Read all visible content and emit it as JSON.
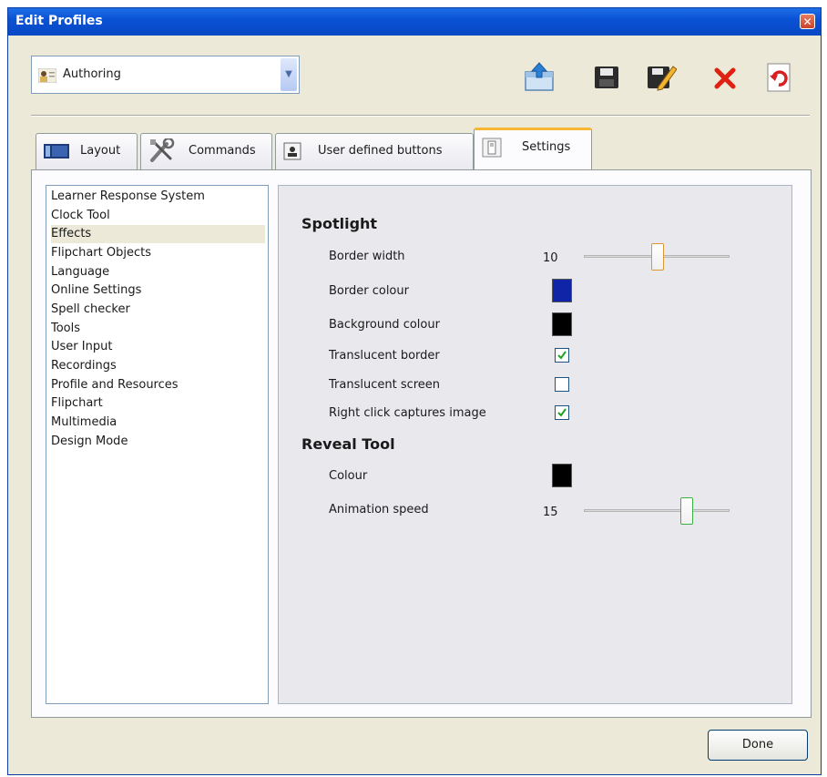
{
  "window": {
    "title": "Edit Profiles"
  },
  "profile_select": {
    "value": "Authoring"
  },
  "toolbar": {
    "icons": [
      "export-icon",
      "save-icon",
      "rename-icon",
      "delete-icon",
      "refresh-icon"
    ],
    "delete_color": "#e02010"
  },
  "tabs": [
    {
      "label": "Layout",
      "icon": "layout-icon"
    },
    {
      "label": "Commands",
      "icon": "tools-icon"
    },
    {
      "label": "User defined buttons",
      "icon": "user-button-icon"
    },
    {
      "label": "Settings",
      "icon": "settings-icon",
      "active": true
    }
  ],
  "settings_list": {
    "items": [
      "Learner Response System",
      "Clock Tool",
      "Effects",
      "Flipchart Objects",
      "Language",
      "Online Settings",
      "Spell checker",
      "Tools",
      "User Input",
      "Recordings",
      "Profile and Resources",
      "Flipchart",
      "Multimedia",
      "Design Mode"
    ],
    "selected": "Effects"
  },
  "spotlight": {
    "title": "Spotlight",
    "border_width": {
      "label": "Border width",
      "value": "10",
      "level": 0.5
    },
    "border_colour": {
      "label": "Border colour",
      "color": "#1024a8"
    },
    "background_colour": {
      "label": "Background colour",
      "color": "#000000"
    },
    "translucent_border": {
      "label": "Translucent border",
      "checked": true
    },
    "translucent_screen": {
      "label": "Translucent screen",
      "checked": false
    },
    "right_click_captures": {
      "label": "Right click captures image",
      "checked": true
    }
  },
  "reveal_tool": {
    "title": "Reveal Tool",
    "colour": {
      "label": "Colour",
      "color": "#000000"
    },
    "animation_speed": {
      "label": "Animation speed",
      "value": "15",
      "level": 0.72
    }
  },
  "footer": {
    "done_label": "Done"
  }
}
